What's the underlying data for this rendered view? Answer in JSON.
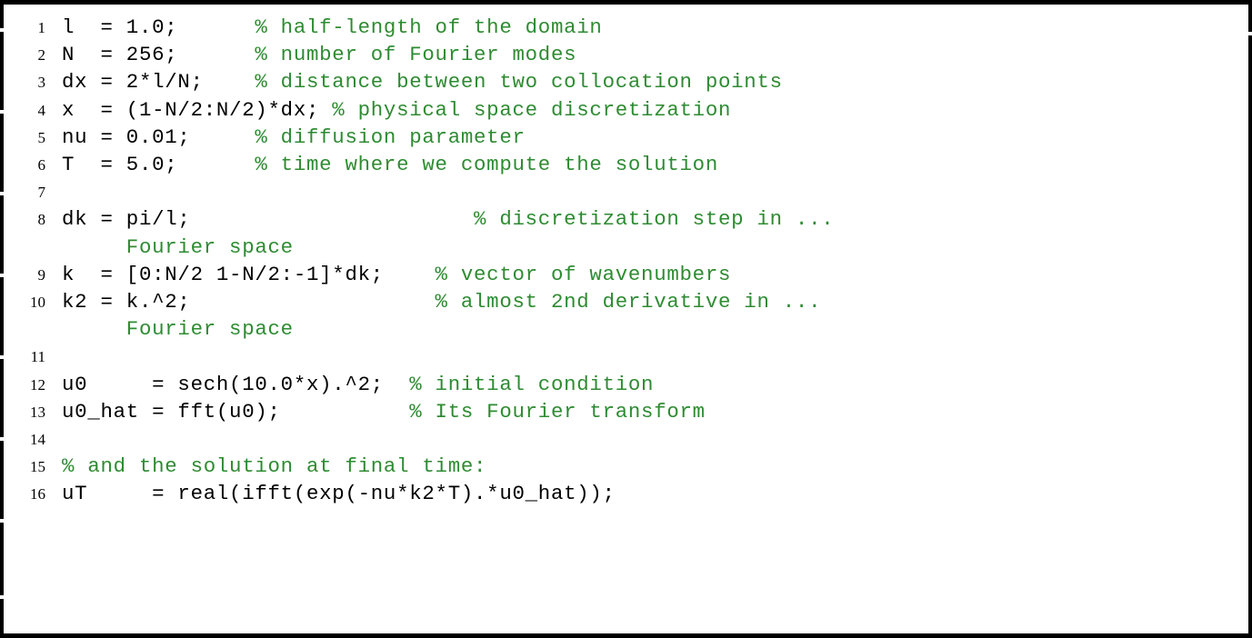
{
  "listing": {
    "language": "MATLAB",
    "comment_color": "#2e8b32",
    "code_color": "#000000",
    "frame_color": "#000000",
    "background_color": "#ffffff",
    "lines": [
      {
        "number": "1",
        "code": "l  = 1.0;      ",
        "comment": "% half-length of the domain",
        "continuation": ""
      },
      {
        "number": "2",
        "code": "N  = 256;      ",
        "comment": "% number of Fourier modes",
        "continuation": ""
      },
      {
        "number": "3",
        "code": "dx = 2*l/N;    ",
        "comment": "% distance between two collocation points",
        "continuation": ""
      },
      {
        "number": "4",
        "code": "x  = (1-N/2:N/2)*dx; ",
        "comment": "% physical space discretization",
        "continuation": ""
      },
      {
        "number": "5",
        "code": "nu = 0.01;     ",
        "comment": "% diffusion parameter",
        "continuation": ""
      },
      {
        "number": "6",
        "code": "T  = 5.0;      ",
        "comment": "% time where we compute the solution",
        "continuation": ""
      },
      {
        "number": "7",
        "code": "",
        "comment": "",
        "continuation": ""
      },
      {
        "number": "8",
        "code": "dk = pi/l;                      ",
        "comment": "% discretization step in ...",
        "continuation": "     Fourier space"
      },
      {
        "number": "9",
        "code": "k  = [0:N/2 1-N/2:-1]*dk;    ",
        "comment": "% vector of wavenumbers",
        "continuation": ""
      },
      {
        "number": "10",
        "code": "k2 = k.^2;                   ",
        "comment": "% almost 2nd derivative in ...",
        "continuation": "     Fourier space"
      },
      {
        "number": "11",
        "code": "",
        "comment": "",
        "continuation": ""
      },
      {
        "number": "12",
        "code": "u0     = sech(10.0*x).^2;  ",
        "comment": "% initial condition",
        "continuation": ""
      },
      {
        "number": "13",
        "code": "u0_hat = fft(u0);          ",
        "comment": "% Its Fourier transform",
        "continuation": ""
      },
      {
        "number": "14",
        "code": "",
        "comment": "",
        "continuation": ""
      },
      {
        "number": "15",
        "code": "",
        "comment": "% and the solution at final time:",
        "continuation": ""
      },
      {
        "number": "16",
        "code": "uT     = real(ifft(exp(-nu*k2*T).*u0_hat));",
        "comment": "",
        "continuation": ""
      }
    ]
  }
}
